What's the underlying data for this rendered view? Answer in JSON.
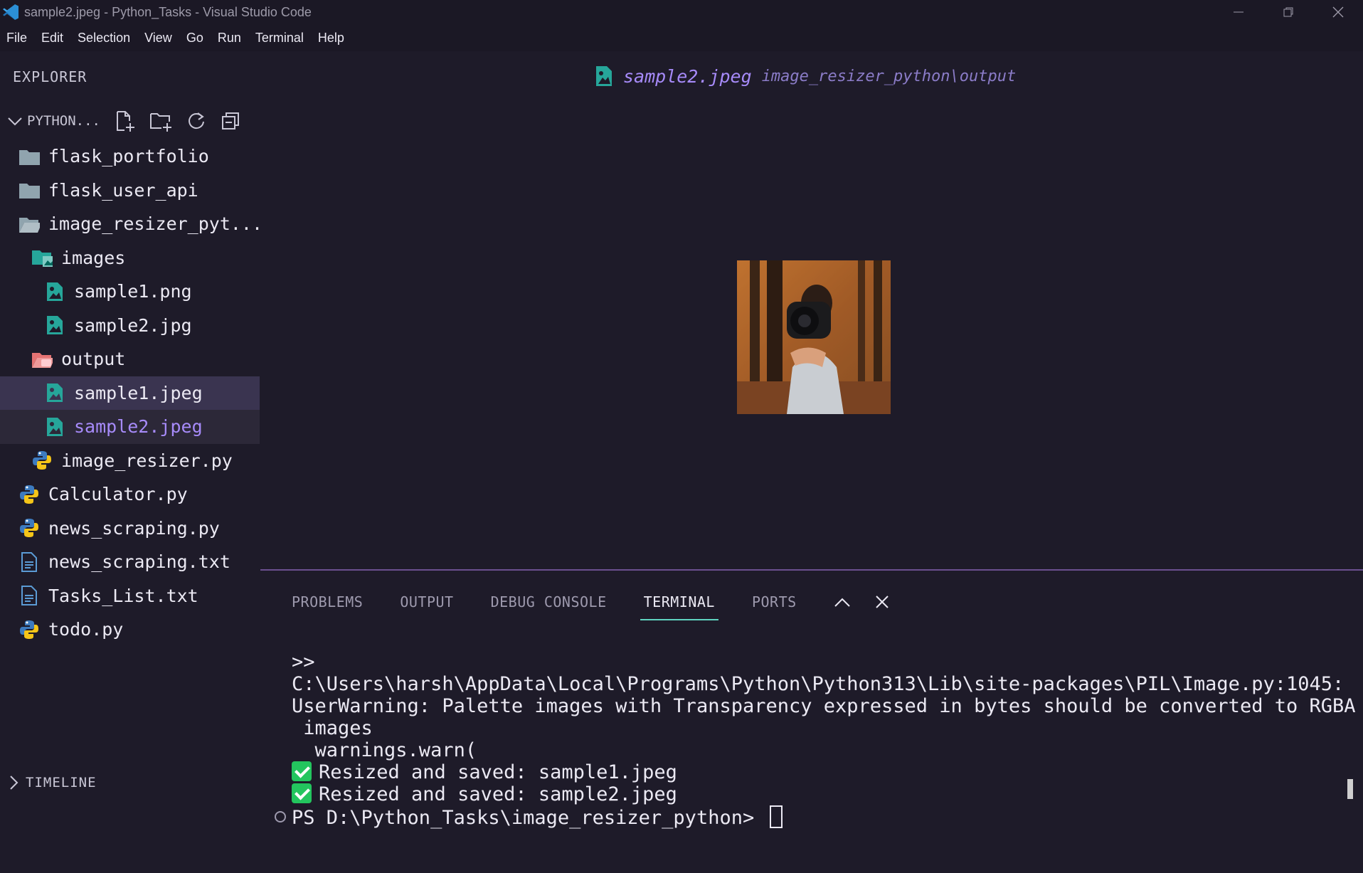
{
  "window": {
    "title": "sample2.jpeg - Python_Tasks - Visual Studio Code"
  },
  "menu": [
    "File",
    "Edit",
    "Selection",
    "View",
    "Go",
    "Run",
    "Terminal",
    "Help"
  ],
  "sidebar": {
    "title": "EXPLORER",
    "section_label": "PYTHON...",
    "items": [
      {
        "label": "flask_portfolio",
        "icon": "folder-icon"
      },
      {
        "label": "flask_user_api",
        "icon": "folder-icon"
      },
      {
        "label": "image_resizer_pyt...",
        "icon": "folder-open-icon"
      },
      {
        "label": "images",
        "icon": "images-folder-icon"
      },
      {
        "label": "sample1.png",
        "icon": "image-file-icon"
      },
      {
        "label": "sample2.jpg",
        "icon": "image-file-icon"
      },
      {
        "label": "output",
        "icon": "output-folder-icon"
      },
      {
        "label": "sample1.jpeg",
        "icon": "image-file-icon"
      },
      {
        "label": "sample2.jpeg",
        "icon": "image-file-icon"
      },
      {
        "label": "image_resizer.py",
        "icon": "python-icon"
      },
      {
        "label": "Calculator.py",
        "icon": "python-icon"
      },
      {
        "label": "news_scraping.py",
        "icon": "python-icon"
      },
      {
        "label": "news_scraping.txt",
        "icon": "text-file-icon"
      },
      {
        "label": "Tasks_List.txt",
        "icon": "text-file-icon"
      },
      {
        "label": "todo.py",
        "icon": "python-icon"
      }
    ],
    "timeline_label": "TIMELINE"
  },
  "editor": {
    "breadcrumb_file": "sample2.jpeg",
    "breadcrumb_path": "image_resizer_python\\output"
  },
  "panel": {
    "tabs": [
      "PROBLEMS",
      "OUTPUT",
      "DEBUG CONSOLE",
      "TERMINAL",
      "PORTS"
    ],
    "active_tab": "TERMINAL",
    "terminal_lines": [
      ">>",
      "C:\\Users\\harsh\\AppData\\Local\\Programs\\Python\\Python313\\Lib\\site-packages\\PIL\\Image.py:1045:",
      "UserWarning: Palette images with Transparency expressed in bytes should be converted to RGBA",
      " images",
      "  warnings.warn(",
      "Resized and saved: sample1.jpeg",
      "Resized and saved: sample2.jpeg",
      "PS D:\\Python_Tasks\\image_resizer_python> "
    ]
  },
  "colors": {
    "accent": "#a78bfa",
    "tab_underline": "#5fd4c0",
    "selection": "#3a3450",
    "check_green": "#23c55e"
  }
}
